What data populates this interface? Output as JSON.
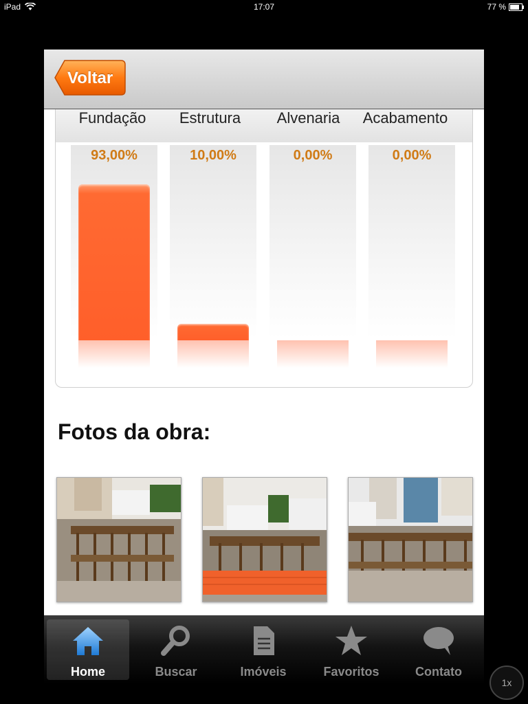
{
  "status_bar": {
    "device": "iPad",
    "time": "17:07",
    "battery": "77 %"
  },
  "navbar": {
    "back_label": "Voltar"
  },
  "chart_data": {
    "type": "bar",
    "categories": [
      "Fundação",
      "Estrutura",
      "Alvenaria",
      "Acabamento"
    ],
    "values": [
      93.0,
      10.0,
      0.0,
      0.0
    ],
    "value_labels": [
      "93,00%",
      "10,00%",
      "0,00%",
      "0,00%"
    ],
    "ylim": [
      0,
      100
    ],
    "bar_color": "#ff6a32",
    "label_color": "#d07b16"
  },
  "photos": {
    "title": "Fotos da obra:",
    "items": [
      {
        "alt": "construction-photo-1"
      },
      {
        "alt": "construction-photo-2"
      },
      {
        "alt": "construction-photo-3"
      }
    ]
  },
  "tabbar": {
    "items": [
      {
        "label": "Home",
        "icon": "home-icon",
        "active": true
      },
      {
        "label": "Buscar",
        "icon": "search-icon"
      },
      {
        "label": "Imóveis",
        "icon": "document-icon"
      },
      {
        "label": "Favoritos",
        "icon": "star-icon"
      },
      {
        "label": "Contato",
        "icon": "speech-bubble-icon"
      }
    ]
  },
  "zoom_button": "1x"
}
